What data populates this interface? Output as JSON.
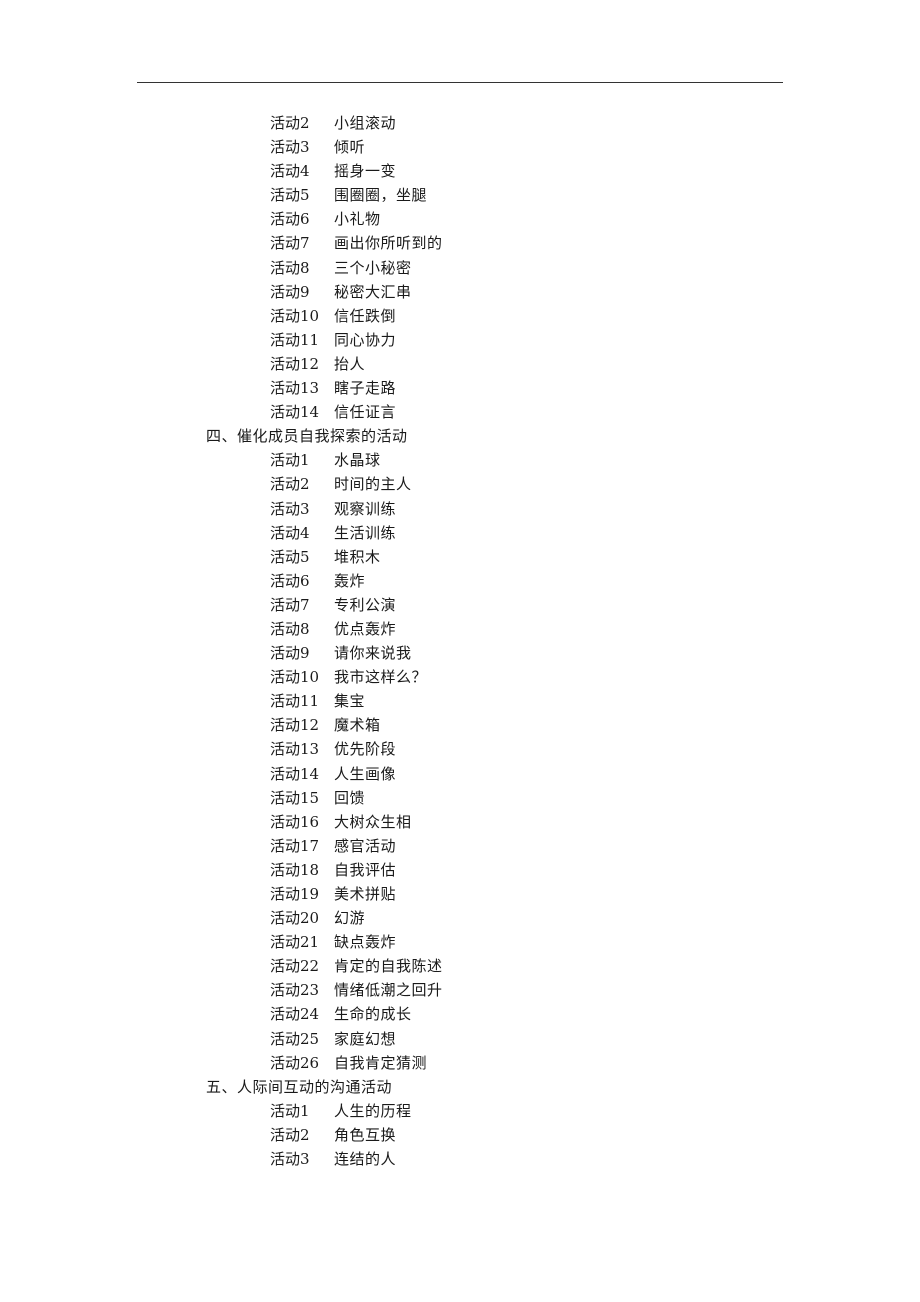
{
  "document": {
    "prefix": "活动",
    "blocks": [
      {
        "type": "items",
        "items": [
          {
            "num": "2",
            "title": "小组滚动"
          },
          {
            "num": "3",
            "title": "倾听"
          },
          {
            "num": "4",
            "title": "摇身一变"
          },
          {
            "num": "5",
            "title": "围圈圈，坐腿"
          },
          {
            "num": "6",
            "title": "小礼物"
          },
          {
            "num": "7",
            "title": "画出你所听到的"
          },
          {
            "num": "8",
            "title": "三个小秘密"
          },
          {
            "num": "9",
            "title": "秘密大汇串"
          },
          {
            "num": "10",
            "title": "信任跌倒"
          },
          {
            "num": "11",
            "title": "同心协力"
          },
          {
            "num": "12",
            "title": "抬人"
          },
          {
            "num": "13",
            "title": "瞎子走路"
          },
          {
            "num": "14",
            "title": "信任证言"
          }
        ]
      },
      {
        "type": "heading",
        "text": "四、催化成员自我探索的活动"
      },
      {
        "type": "items",
        "items": [
          {
            "num": "1",
            "title": "水晶球"
          },
          {
            "num": "2",
            "title": "时间的主人"
          },
          {
            "num": "3",
            "title": "观察训练"
          },
          {
            "num": "4",
            "title": "生活训练"
          },
          {
            "num": "5",
            "title": "堆积木"
          },
          {
            "num": "6",
            "title": "轰炸"
          },
          {
            "num": "7",
            "title": "专利公演"
          },
          {
            "num": "8",
            "title": "优点轰炸"
          },
          {
            "num": "9",
            "title": "请你来说我"
          },
          {
            "num": "10",
            "title": "我市这样么？"
          },
          {
            "num": "11",
            "title": "集宝"
          },
          {
            "num": "12",
            "title": "魔术箱"
          },
          {
            "num": "13",
            "title": "优先阶段"
          },
          {
            "num": "14",
            "title": "人生画像"
          },
          {
            "num": "15",
            "title": "回馈"
          },
          {
            "num": "16",
            "title": "大树众生相"
          },
          {
            "num": "17",
            "title": "感官活动"
          },
          {
            "num": "18",
            "title": "自我评估"
          },
          {
            "num": "19",
            "title": "美术拼贴"
          },
          {
            "num": "20",
            "title": "幻游"
          },
          {
            "num": "21",
            "title": "缺点轰炸"
          },
          {
            "num": "22",
            "title": "肯定的自我陈述"
          },
          {
            "num": "23",
            "title": "情绪低潮之回升"
          },
          {
            "num": "24",
            "title": "生命的成长"
          },
          {
            "num": "25",
            "title": "家庭幻想"
          },
          {
            "num": "26",
            "title": "自我肯定猜测"
          }
        ]
      },
      {
        "type": "heading",
        "text": "五、人际间互动的沟通活动"
      },
      {
        "type": "items",
        "items": [
          {
            "num": "1",
            "title": "人生的历程"
          },
          {
            "num": "2",
            "title": "角色互换"
          },
          {
            "num": "3",
            "title": "连结的人"
          }
        ]
      }
    ]
  }
}
